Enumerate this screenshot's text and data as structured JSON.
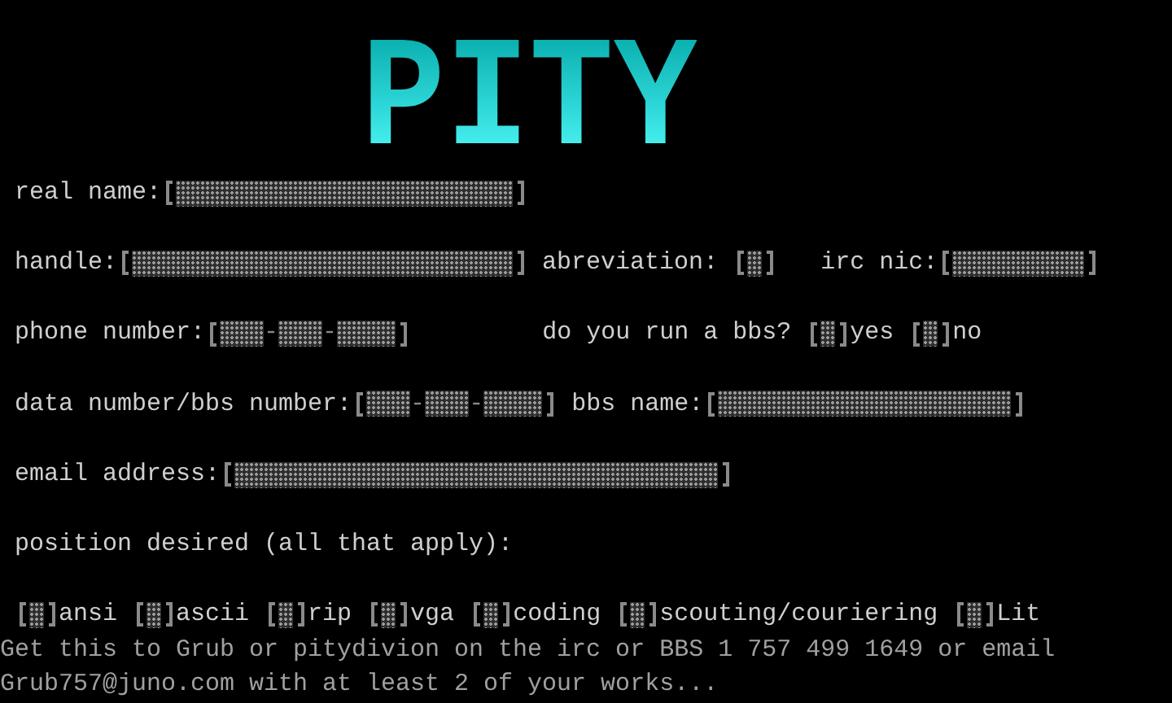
{
  "logo": "PITY",
  "form_rows": [
    {
      "items": [
        {
          "kind": "text_field",
          "label": "real name:"
        }
      ]
    },
    {
      "items": [
        {
          "kind": "text_field",
          "label": "handle:"
        },
        {
          "kind": "text_field",
          "label": "abreviation: "
        },
        {
          "kind": "text_field",
          "label": "irc nic:"
        }
      ]
    },
    {
      "items": [
        {
          "kind": "phone_field",
          "label": "phone number:",
          "separator": "-"
        },
        {
          "kind": "question",
          "label": "do you run a bbs?",
          "options": [
            {
              "label": "yes",
              "checked": false
            },
            {
              "label": "no",
              "checked": false
            }
          ]
        }
      ]
    },
    {
      "items": [
        {
          "kind": "phone_field",
          "label": "data number/bbs number:",
          "separator": "-"
        },
        {
          "kind": "text_field",
          "label": "bbs name:"
        }
      ]
    },
    {
      "items": [
        {
          "kind": "text_field",
          "label": "email address:"
        }
      ]
    },
    {
      "items": [
        {
          "kind": "heading",
          "label": "position desired (all that apply):"
        }
      ]
    },
    {
      "items": [
        {
          "kind": "checkbox",
          "label": "ansi",
          "checked": false
        },
        {
          "kind": "checkbox",
          "label": "ascii",
          "checked": false
        },
        {
          "kind": "checkbox",
          "label": "rip",
          "checked": false
        },
        {
          "kind": "checkbox",
          "label": "vga",
          "checked": false
        },
        {
          "kind": "checkbox",
          "label": "coding",
          "checked": false
        },
        {
          "kind": "checkbox",
          "label": "scouting/couriering",
          "checked": false
        },
        {
          "kind": "checkbox",
          "label": "Lit",
          "checked": false
        }
      ]
    }
  ],
  "footer": [
    "Get this to Grub or pitydivion on the irc or BBS 1 757 499 1649 or email",
    "Grub757@juno.com with at least 2 of your works..."
  ]
}
